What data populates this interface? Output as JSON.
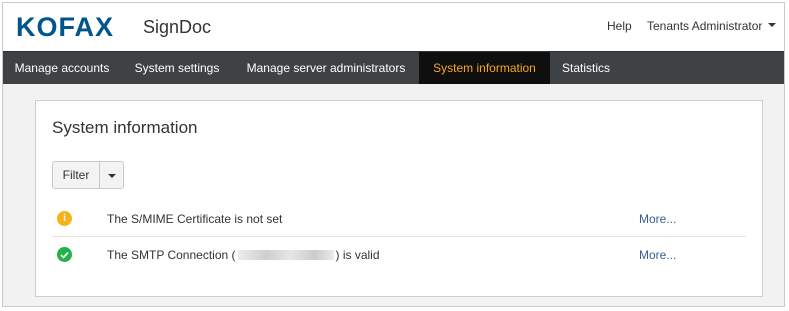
{
  "header": {
    "logo": "KOFAX",
    "app_name": "SignDoc",
    "help": "Help",
    "user_menu": "Tenants Administrator"
  },
  "nav": {
    "items": [
      {
        "label": "Manage accounts"
      },
      {
        "label": "System settings"
      },
      {
        "label": "Manage server administrators"
      },
      {
        "label": "System information",
        "active": true
      },
      {
        "label": "Statistics"
      }
    ]
  },
  "panel": {
    "title": "System information",
    "filter_label": "Filter",
    "rows": [
      {
        "status": "warning",
        "icon": "info-icon",
        "text": "The S/MIME Certificate is not set",
        "link": "More..."
      },
      {
        "status": "ok",
        "icon": "check-circle-icon",
        "text_before": "The SMTP Connection (",
        "text_after": ") is valid",
        "link": "More..."
      }
    ]
  },
  "colors": {
    "brand": "#00558c",
    "nav_bg": "#3f4244",
    "nav_active_bg": "#0f0f0f",
    "nav_active_text": "#f6a623",
    "warning": "#f6b21a",
    "ok": "#1fb348",
    "link": "#3a5d8f"
  }
}
